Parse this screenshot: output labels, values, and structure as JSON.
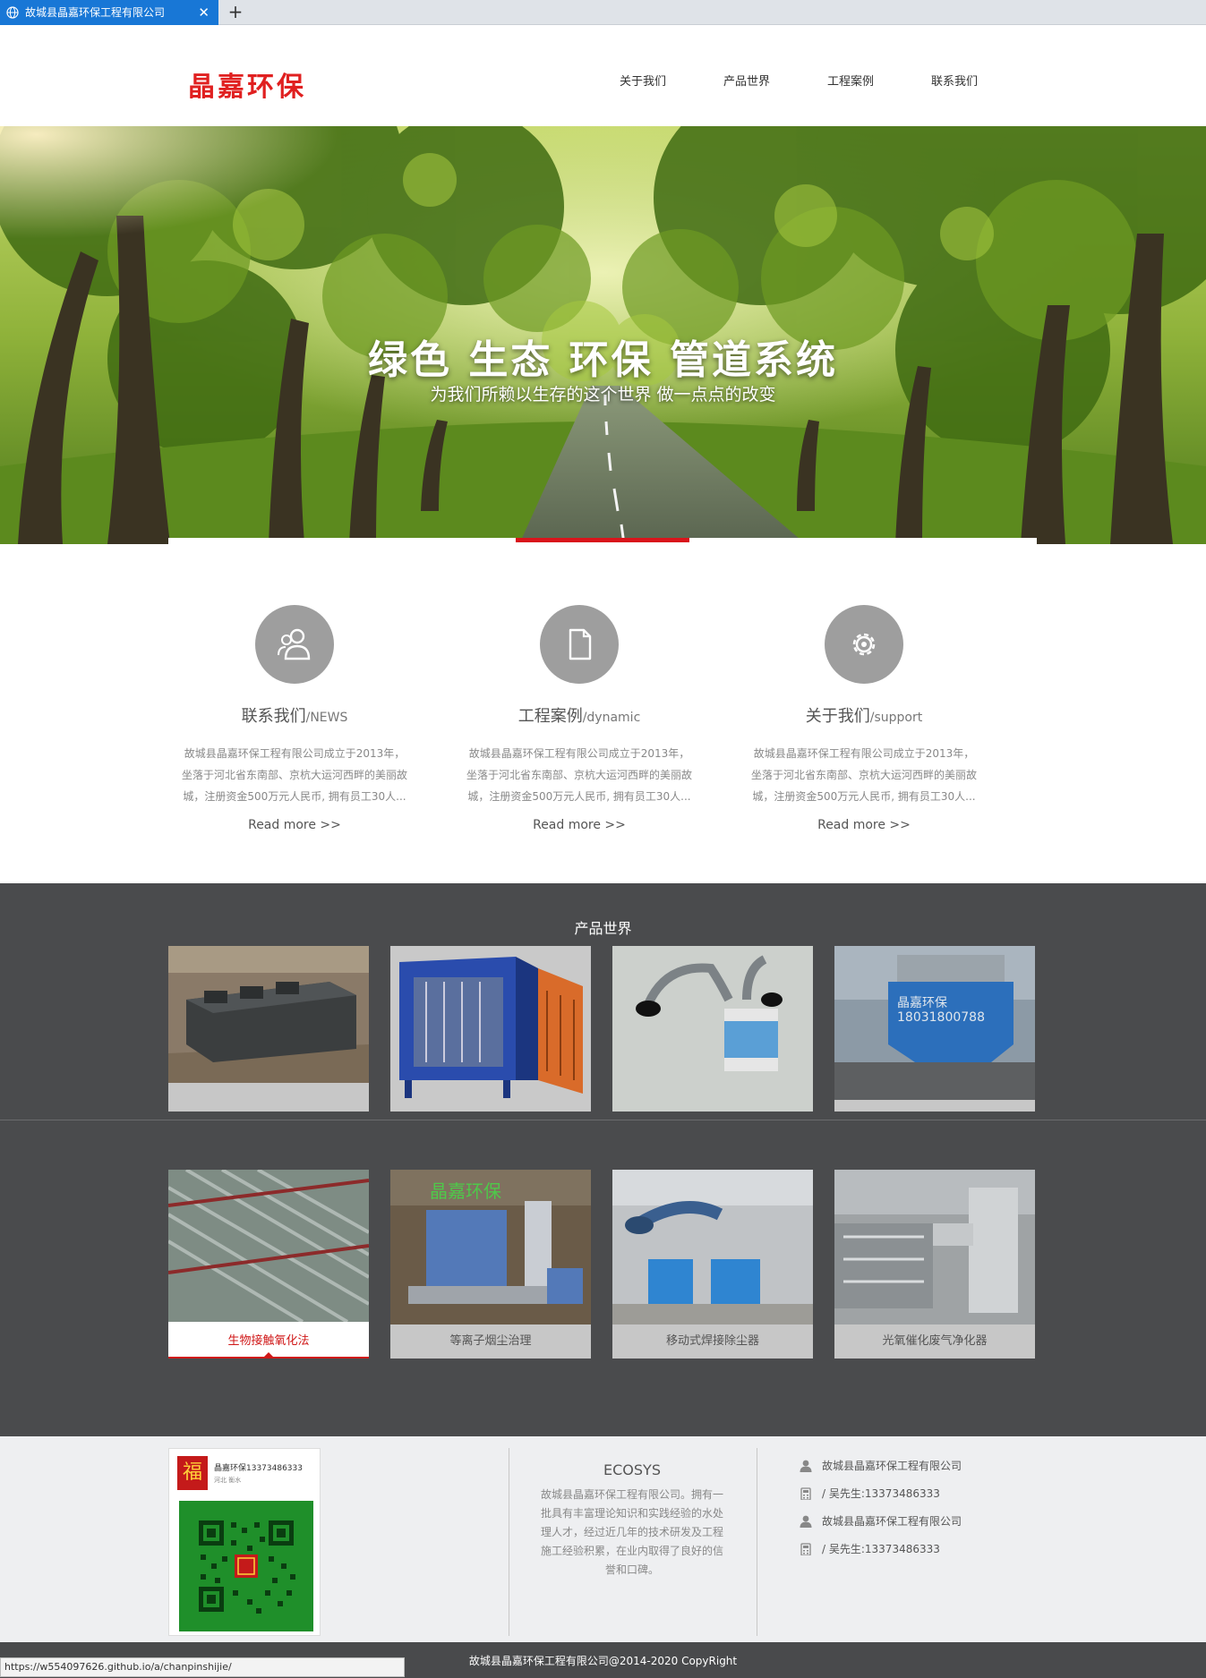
{
  "browser": {
    "tab_title": "故城县晶嘉环保工程有限公司",
    "tab_close": "✕",
    "new_tab": "+",
    "status_url": "https://w554097626.github.io/a/chanpinshijie/"
  },
  "header": {
    "logo": "晶嘉环保",
    "nav": [
      "关于我们",
      "产品世界",
      "工程案例",
      "联系我们"
    ]
  },
  "hero": {
    "title": "绿色 生态 环保 管道系统",
    "subtitle": "为我们所赖以生存的这个世界 做一点点的改变"
  },
  "features": [
    {
      "icon": "users-icon",
      "title": "联系我们",
      "title_suffix": "/NEWS",
      "text": "故城县晶嘉环保工程有限公司成立于2013年，坐落于河北省东南部、京杭大运河西畔的美丽故城，注册资金500万元人民币, 拥有员工30人...",
      "more": "Read more >>"
    },
    {
      "icon": "document-icon",
      "title": "工程案例",
      "title_suffix": "/dynamic",
      "text": "故城县晶嘉环保工程有限公司成立于2013年，坐落于河北省东南部、京杭大运河西畔的美丽故城，注册资金500万元人民币, 拥有员工30人...",
      "more": "Read more >>"
    },
    {
      "icon": "gear-icon",
      "title": "关于我们",
      "title_suffix": "/support",
      "text": "故城县晶嘉环保工程有限公司成立于2013年，坐落于河北省东南部、京杭大运河西畔的美丽故城，注册资金500万元人民币, 拥有员工30人...",
      "more": "Read more >>"
    }
  ],
  "products": {
    "title": "产品世界",
    "row1": [
      {
        "caption": "",
        "watermark": ""
      },
      {
        "caption": "",
        "watermark": ""
      },
      {
        "caption": "",
        "watermark": ""
      },
      {
        "caption": "",
        "watermark": "晶嘉环保\n18031800788"
      }
    ],
    "row2": [
      {
        "caption": "生物接触氧化法",
        "watermark": "",
        "active": true
      },
      {
        "caption": "等离子烟尘治理",
        "watermark": "晶嘉环保"
      },
      {
        "caption": "移动式焊接除尘器",
        "watermark": ""
      },
      {
        "caption": "光氧催化废气净化器",
        "watermark": ""
      }
    ]
  },
  "footer": {
    "qr_name": "晶嘉环保13373486333",
    "qr_location": "河北 衡水",
    "qr_badge": "福",
    "eco_title": "ECOSYS",
    "eco_text": "故城县晶嘉环保工程有限公司。拥有一批具有丰富理论知识和实践经验的水处理人才，经过近几年的技术研发及工程施工经验积累，在业内取得了良好的信誉和口碑。",
    "contacts": [
      {
        "icon": "person-icon",
        "text": "故城县晶嘉环保工程有限公司"
      },
      {
        "icon": "phone-icon",
        "text": "/ 吴先生:13373486333"
      },
      {
        "icon": "person-icon",
        "text": "故城县晶嘉环保工程有限公司"
      },
      {
        "icon": "phone-icon",
        "text": "/ 吴先生:13373486333"
      }
    ],
    "copyright": "故城县晶嘉环保工程有限公司@2014-2020 CopyRight"
  }
}
